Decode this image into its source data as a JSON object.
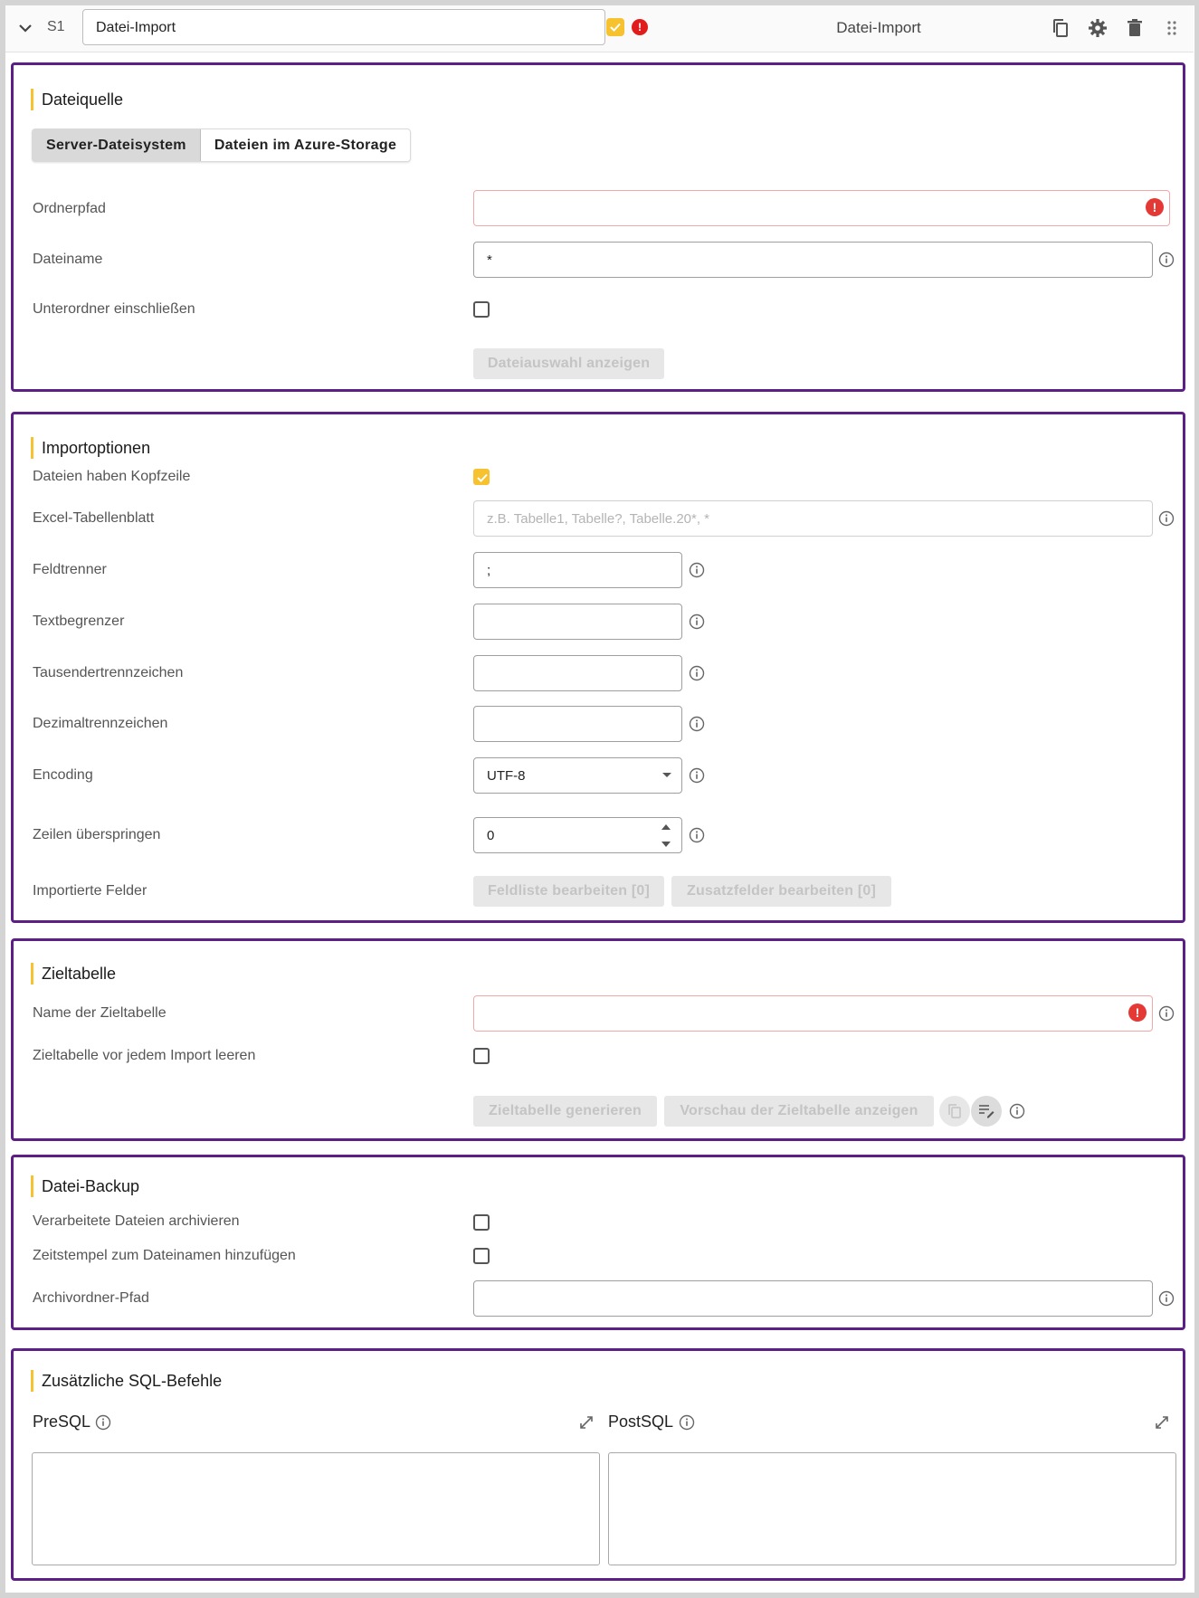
{
  "header": {
    "step": "S1",
    "name_value": "Datei-Import",
    "title": "Datei-Import",
    "icons": [
      "copy-icon",
      "gear-icon",
      "trash-icon",
      "drag-handle-icon"
    ]
  },
  "dateiquelle": {
    "title": "Dateiquelle",
    "tabs": [
      "Server-Dateisystem",
      "Dateien im Azure-Storage"
    ],
    "ordnerpfad_label": "Ordnerpfad",
    "ordnerpfad_value": "",
    "dateiname_label": "Dateiname",
    "dateiname_value": "*",
    "unterordner_label": "Unterordner einschließen",
    "dateiauswahl_button": "Dateiauswahl anzeigen"
  },
  "importoptionen": {
    "title": "Importoptionen",
    "kopfzeile_label": "Dateien haben Kopfzeile",
    "excel_label": "Excel-Tabellenblatt",
    "excel_placeholder": "z.B. Tabelle1, Tabelle?, Tabelle.20*, *",
    "feldtrenner_label": "Feldtrenner",
    "feldtrenner_value": ";",
    "textbegrenzer_label": "Textbegrenzer",
    "tausender_label": "Tausendertrennzeichen",
    "dezimal_label": "Dezimaltrennzeichen",
    "encoding_label": "Encoding",
    "encoding_value": "UTF-8",
    "zeilen_label": "Zeilen überspringen",
    "zeilen_value": "0",
    "felder_label": "Importierte Felder",
    "feldliste_button": "Feldliste bearbeiten [0]",
    "zusatzfelder_button": "Zusatzfelder bearbeiten [0]"
  },
  "zieltabelle": {
    "title": "Zieltabelle",
    "name_label": "Name der Zieltabelle",
    "name_value": "",
    "leeren_label": "Zieltabelle vor jedem Import leeren",
    "generieren_button": "Zieltabelle generieren",
    "vorschau_button": "Vorschau der Zieltabelle anzeigen"
  },
  "backup": {
    "title": "Datei-Backup",
    "archivieren_label": "Verarbeitete Dateien archivieren",
    "zeitstempel_label": "Zeitstempel zum Dateinamen hinzufügen",
    "archivpfad_label": "Archivordner-Pfad",
    "archivpfad_value": ""
  },
  "sql": {
    "title": "Zusätzliche SQL-Befehle",
    "pre_label": "PreSQL",
    "post_label": "PostSQL"
  },
  "colors": {
    "accent": "#f6c230",
    "section_border": "#5b1f85",
    "error": "#e53935"
  }
}
